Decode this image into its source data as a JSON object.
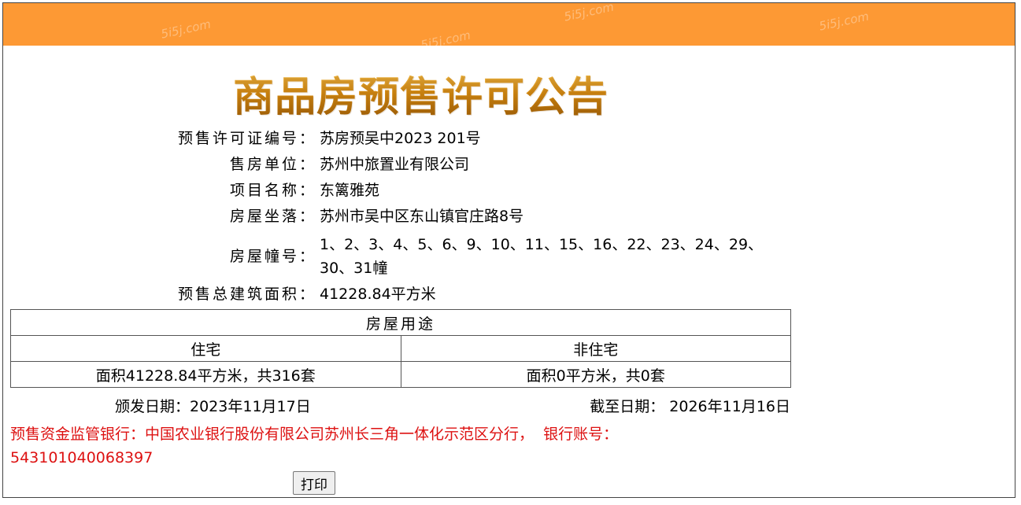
{
  "watermarks": [
    "5i5j.com",
    "5i5j.com",
    "5i5j.com",
    "5i5j.com"
  ],
  "title": "商品房预售许可公告",
  "fields": {
    "permit_label": "预售许可证编号：",
    "permit_value": "苏房预吴中2023 201号",
    "seller_label": "售房单位：",
    "seller_value": "苏州中旅置业有限公司",
    "project_label": "项目名称：",
    "project_value": "东篱雅苑",
    "location_label": "房屋坐落：",
    "location_value": "苏州市吴中区东山镇官庄路8号",
    "buildings_label": "房屋幢号：",
    "buildings_value": "1、2、3、4、5、6、9、10、11、15、16、22、23、24、29、30、31幢",
    "area_label": "预售总建筑面积：",
    "area_value": "41228.84平方米"
  },
  "usage_table": {
    "header": "房屋用途",
    "columns": [
      "住宅",
      "非住宅"
    ],
    "values": [
      "面积41228.84平方米，共316套",
      "面积0平方米，共0套"
    ]
  },
  "dates": {
    "issue": "颁发日期：2023年11月17日",
    "expire": "截至日期：  2026年11月16日"
  },
  "bank": {
    "label": "预售资金监管银行：",
    "name": "中国农业银行股份有限公司苏州长三角一体化示范区分行，",
    "account_label": "  银行账号：",
    "account": "543101040068397"
  },
  "print_label": "打印",
  "colors": {
    "topbar": "#fd9934",
    "bank_text": "#dd1111"
  }
}
